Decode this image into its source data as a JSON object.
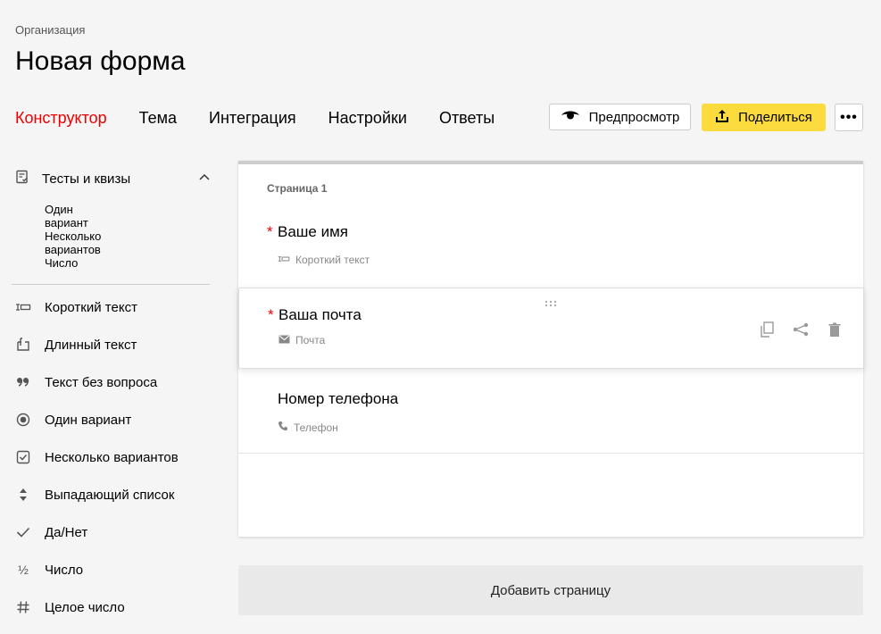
{
  "header": {
    "breadcrumb": "Организация",
    "title": "Новая форма"
  },
  "tabs": [
    {
      "label": "Конструктор",
      "active": true
    },
    {
      "label": "Тема",
      "active": false
    },
    {
      "label": "Интеграция",
      "active": false
    },
    {
      "label": "Настройки",
      "active": false
    },
    {
      "label": "Ответы",
      "active": false
    }
  ],
  "toolbar": {
    "preview_label": "Предпросмотр",
    "share_label": "Поделиться",
    "more_label": "•••"
  },
  "sidebar": {
    "group": {
      "label": "Тесты и квизы",
      "expanded": true,
      "items": [
        "Один вариант",
        "Несколько вариантов",
        "Число"
      ]
    },
    "items": [
      {
        "label": "Короткий текст",
        "icon": "short-text-icon"
      },
      {
        "label": "Длинный текст",
        "icon": "long-text-icon"
      },
      {
        "label": "Текст без вопроса",
        "icon": "quote-icon"
      },
      {
        "label": "Один вариант",
        "icon": "radio-icon"
      },
      {
        "label": "Несколько вариантов",
        "icon": "checkbox-icon"
      },
      {
        "label": "Выпадающий список",
        "icon": "dropdown-icon"
      },
      {
        "label": "Да/Нет",
        "icon": "check-icon"
      },
      {
        "label": "Число",
        "icon": "fraction-icon"
      },
      {
        "label": "Целое число",
        "icon": "hash-icon"
      }
    ]
  },
  "form": {
    "page_label": "Страница 1",
    "questions": [
      {
        "title": "Ваше имя",
        "required": true,
        "type": "Короткий текст",
        "type_icon": "short-text-icon"
      },
      {
        "title": "Ваша почта",
        "required": true,
        "type": "Почта",
        "type_icon": "mail-icon"
      },
      {
        "title": "Номер телефона",
        "required": false,
        "type": "Телефон",
        "type_icon": "phone-icon"
      }
    ],
    "add_page_label": "Добавить страницу"
  },
  "colors": {
    "accent": "#e00000",
    "share_button": "#fcdb3e"
  }
}
